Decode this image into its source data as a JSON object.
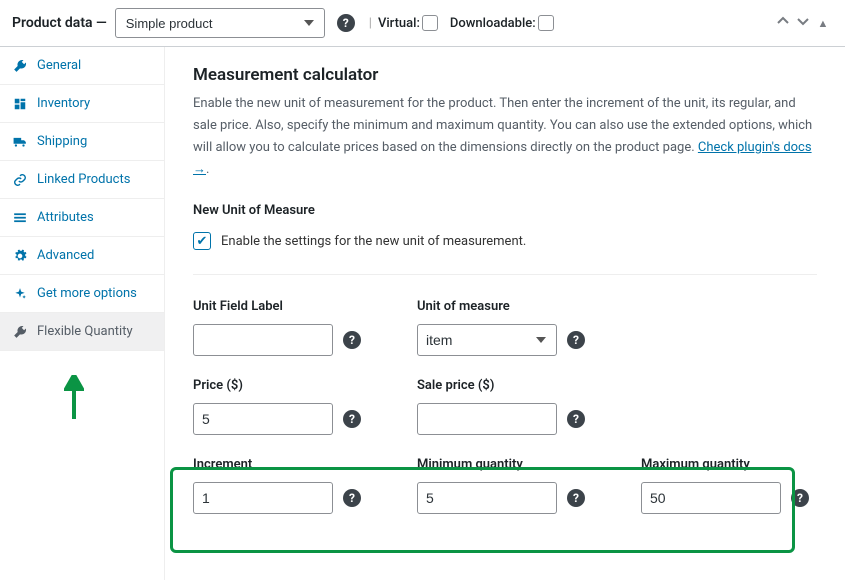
{
  "header": {
    "title": "Product data —",
    "product_type": "Simple product",
    "virtual_label": "Virtual:",
    "downloadable_label": "Downloadable:"
  },
  "sidebar": {
    "items": [
      {
        "label": "General",
        "icon": "wrench"
      },
      {
        "label": "Inventory",
        "icon": "inventory"
      },
      {
        "label": "Shipping",
        "icon": "truck"
      },
      {
        "label": "Linked Products",
        "icon": "link"
      },
      {
        "label": "Attributes",
        "icon": "bars"
      },
      {
        "label": "Advanced",
        "icon": "gear"
      },
      {
        "label": "Get more options",
        "icon": "sparkle"
      },
      {
        "label": "Flexible Quantity",
        "icon": "wrench",
        "active": true
      }
    ]
  },
  "main": {
    "heading": "Measurement calculator",
    "description_pre": "Enable the new unit of measurement for the product. Then enter the increment of the unit, its regular, and sale price. Also, specify the minimum and maximum quantity. You can also use the extended options, which will allow you to calculate prices based on the dimensions directly on the product page. ",
    "doc_link_text": "Check plugin's docs →",
    "doc_link_suffix": ".",
    "section_label": "New Unit of Measure",
    "enable_checked": true,
    "enable_text": "Enable the settings for the new unit of measurement.",
    "fields": {
      "unit_label": {
        "label": "Unit Field Label",
        "value": ""
      },
      "unit_of_measure": {
        "label": "Unit of measure",
        "value": "item"
      },
      "price": {
        "label": "Price ($)",
        "value": "5"
      },
      "sale_price": {
        "label": "Sale price ($)",
        "value": ""
      },
      "increment": {
        "label": "Increment",
        "value": "1"
      },
      "min_qty": {
        "label": "Minimum quantity",
        "value": "5"
      },
      "max_qty": {
        "label": "Maximum quantity",
        "value": "50"
      }
    }
  }
}
